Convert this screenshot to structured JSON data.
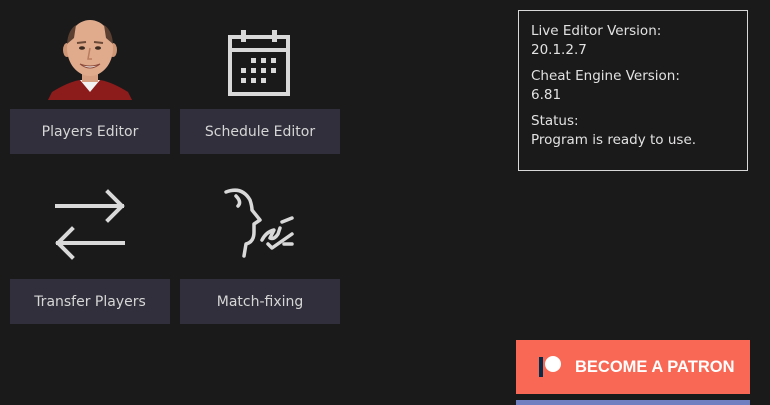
{
  "tiles": {
    "players_editor": {
      "label": "Players Editor",
      "icon": "player-portrait-icon"
    },
    "schedule_editor": {
      "label": "Schedule Editor",
      "icon": "calendar-icon"
    },
    "transfer_players": {
      "label": "Transfer Players",
      "icon": "transfer-arrows-icon"
    },
    "match_fixing": {
      "label": "Match-fixing",
      "icon": "whisper-icon"
    }
  },
  "info": {
    "live_editor_label": "Live Editor Version:",
    "live_editor_value": "20.1.2.7",
    "cheat_engine_label": "Cheat Engine Version:",
    "cheat_engine_value": "6.81",
    "status_label": "Status:",
    "status_value": "Program is ready to use."
  },
  "patreon": {
    "label": "BECOME A PATRON",
    "icon": "patreon-logo-icon"
  },
  "colors": {
    "background": "#1b1a1b",
    "tile_button": "#302f3b",
    "patreon": "#f96854",
    "icon_stroke": "#d9d9d9"
  }
}
